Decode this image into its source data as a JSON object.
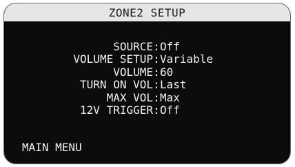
{
  "title": "ZONE2 SETUP",
  "settings": [
    {
      "label": "SOURCE",
      "value": "Off"
    },
    {
      "label": "VOLUME SETUP",
      "value": "Variable"
    },
    {
      "label": "VOLUME",
      "value": "60"
    },
    {
      "label": "TURN ON VOL",
      "value": "Last"
    },
    {
      "label": "MAX VOL",
      "value": "Max"
    },
    {
      "label": "12V TRIGGER",
      "value": "Off"
    }
  ],
  "menu": {
    "main_menu": "MAIN MENU"
  },
  "colors": {
    "background": "#0c0c0c",
    "title_bar": "#e6e6e6",
    "text": "#f2f2f2"
  }
}
